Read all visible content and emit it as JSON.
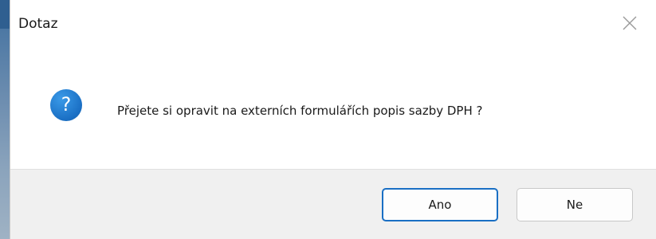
{
  "dialog": {
    "title": "Dotaz",
    "message": "Přejete si opravit na externích formulářích popis sazby DPH ?",
    "icon": "question-icon",
    "close_icon": "close-icon"
  },
  "buttons": {
    "yes_label": "Ano",
    "no_label": "Ne"
  },
  "colors": {
    "accent": "#1a6fc4",
    "footer_bg": "#f0f0f0"
  }
}
